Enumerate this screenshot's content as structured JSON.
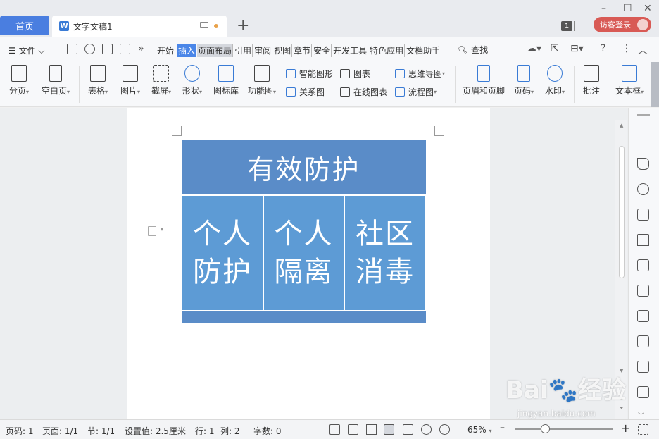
{
  "tabs": {
    "home": "首页",
    "doc_icon": "W",
    "doc_title": "文字文稿1",
    "add": "+"
  },
  "titlebar": {
    "badge_count": "1",
    "login_label": "访客登录"
  },
  "menu": {
    "file": "文件",
    "tabs": [
      "开始",
      "插入",
      "页面布局",
      "引用",
      "审阅",
      "视图",
      "章节",
      "安全",
      "开发工具",
      "特色应用",
      "文档助手"
    ],
    "active_tab": "插入",
    "search": "查找"
  },
  "ribbon": {
    "buttons": [
      {
        "label": "分页",
        "icon": "page-break-icon"
      },
      {
        "label": "空白页",
        "icon": "blank-page-icon"
      },
      {
        "label": "表格",
        "icon": "table-icon"
      },
      {
        "label": "图片",
        "icon": "picture-icon"
      },
      {
        "label": "截屏",
        "icon": "screenshot-icon"
      },
      {
        "label": "形状",
        "icon": "shape-icon"
      },
      {
        "label": "图标库",
        "icon": "icon-library-icon"
      },
      {
        "label": "功能图",
        "icon": "function-chart-icon"
      },
      {
        "label": "页眉和页脚",
        "icon": "header-footer-icon"
      },
      {
        "label": "页码",
        "icon": "page-number-icon"
      },
      {
        "label": "水印",
        "icon": "watermark-icon"
      },
      {
        "label": "批注",
        "icon": "comment-icon"
      },
      {
        "label": "文本框",
        "icon": "text-box-icon"
      }
    ],
    "small": [
      {
        "label": "智能图形",
        "icon": "smart-art-icon"
      },
      {
        "label": "图表",
        "icon": "chart-icon"
      },
      {
        "label": "思维导图",
        "icon": "mind-map-icon"
      },
      {
        "label": "关系图",
        "icon": "relation-chart-icon"
      },
      {
        "label": "在线图表",
        "icon": "online-chart-icon"
      },
      {
        "label": "流程图",
        "icon": "flowchart-icon"
      }
    ]
  },
  "document": {
    "header": "有效防护",
    "cells": [
      {
        "line1": "个人",
        "line2": "防护"
      },
      {
        "line1": "个人",
        "line2": "隔离"
      },
      {
        "line1": "社区",
        "line2": "消毒"
      }
    ],
    "colors": {
      "header_bg": "#5a8cc8",
      "cell_bg": "#5d9bd5"
    }
  },
  "status": {
    "page": "页码: 1",
    "pages": "页面: 1/1",
    "section": "节: 1/1",
    "setting": "设置值: 2.5厘米",
    "row": "行: 1",
    "col": "列: 2",
    "words": "字数: 0",
    "zoom": "65%"
  },
  "watermark": {
    "brand": "Bai",
    "brand2": "经验",
    "url": "jingyan.baidu.com"
  }
}
